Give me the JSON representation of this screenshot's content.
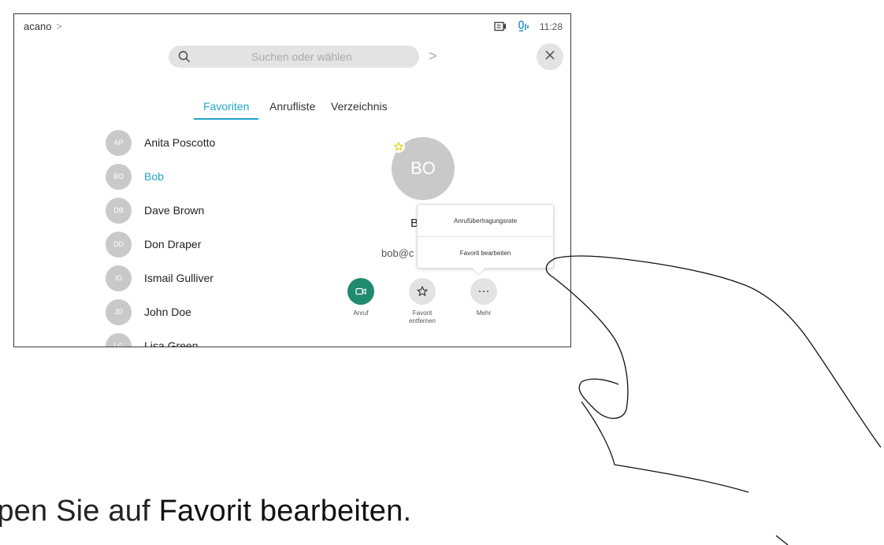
{
  "topbar": {
    "breadcrumb": "acano",
    "time": "11:28"
  },
  "search": {
    "placeholder": "Suchen oder wählen"
  },
  "tabs": [
    {
      "label": "Favoriten",
      "active": true
    },
    {
      "label": "Anrufliste",
      "active": false
    },
    {
      "label": "Verzeichnis",
      "active": false
    }
  ],
  "contacts": [
    {
      "initials": "AP",
      "name": "Anita Poscotto"
    },
    {
      "initials": "BO",
      "name": "Bob"
    },
    {
      "initials": "DB",
      "name": "Dave Brown"
    },
    {
      "initials": "DD",
      "name": "Don Draper"
    },
    {
      "initials": "IG",
      "name": "Ismail Gulliver"
    },
    {
      "initials": "JD",
      "name": "John Doe"
    },
    {
      "initials": "LG",
      "name": "Lisa Green"
    }
  ],
  "detail": {
    "initials": "BO",
    "name": "B",
    "email": "bob@c"
  },
  "actions": {
    "call": "Anruf",
    "unfavorite_line1": "Favorit",
    "unfavorite_line2": "entfernen",
    "more": "Mehr"
  },
  "popup": {
    "item1": "Anrufübertragungsrate",
    "item2": "Favorit bearbeiten"
  },
  "caption": {
    "prefix": "ppen Sie auf ",
    "emphasis": "Favorit bearbeiten",
    "suffix": "."
  },
  "colors": {
    "accent": "#22a5c9",
    "call_green": "#1e8a6e",
    "star_yellow": "#f2c500"
  }
}
